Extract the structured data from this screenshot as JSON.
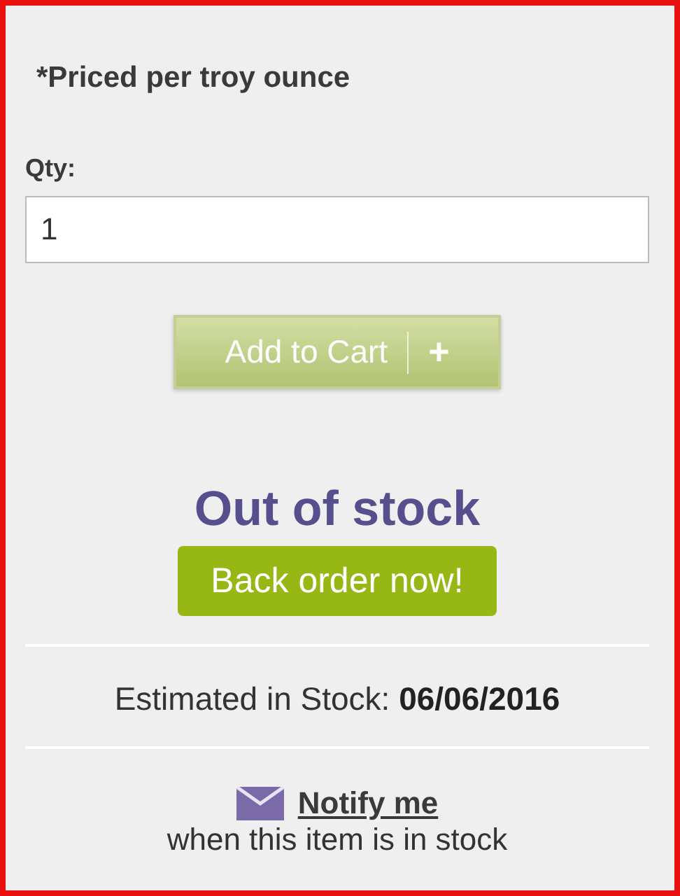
{
  "price_note": "*Priced per troy ounce",
  "quantity": {
    "label": "Qty:",
    "value": "1"
  },
  "add_to_cart": {
    "label": "Add to Cart",
    "icon_text": "+",
    "disabled": true
  },
  "stock_status": "Out of stock",
  "back_order_button": "Back order now!",
  "estimate": "Estimated in Stock: **06/06/2016**",
  "notify": {
    "link": "Notify me",
    "note": "when this item is in stock"
  }
}
